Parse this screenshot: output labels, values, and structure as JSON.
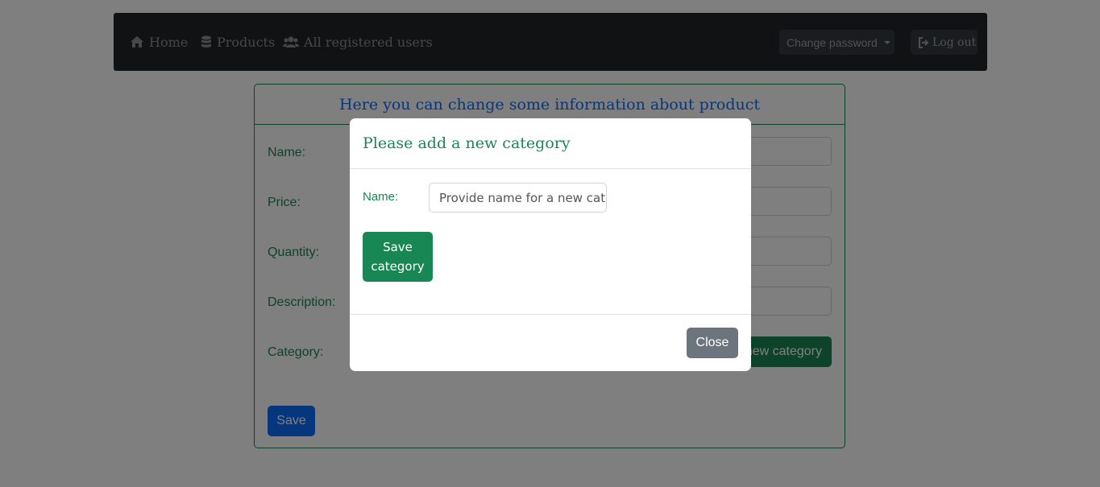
{
  "navbar": {
    "home": "Home",
    "products": "Products",
    "users": "All registered users",
    "change_password": "Change password",
    "logout": "Log out"
  },
  "card": {
    "header": "Here you can change some information about product",
    "labels": {
      "name": "Name:",
      "price": "Price:",
      "quantity": "Quantity:",
      "description": "Description:",
      "category": "Category:"
    },
    "add_category_button": "Add new category",
    "save_button": "Save"
  },
  "modal": {
    "title": "Please add a new category",
    "name_label": "Name:",
    "name_placeholder": "Provide name for a new category",
    "save_button": "Save category",
    "close_button": "Close"
  },
  "colors": {
    "accent_green": "#198754",
    "primary_blue": "#0d6efd",
    "secondary_gray": "#6c757d",
    "navbar_dark": "#212529"
  }
}
